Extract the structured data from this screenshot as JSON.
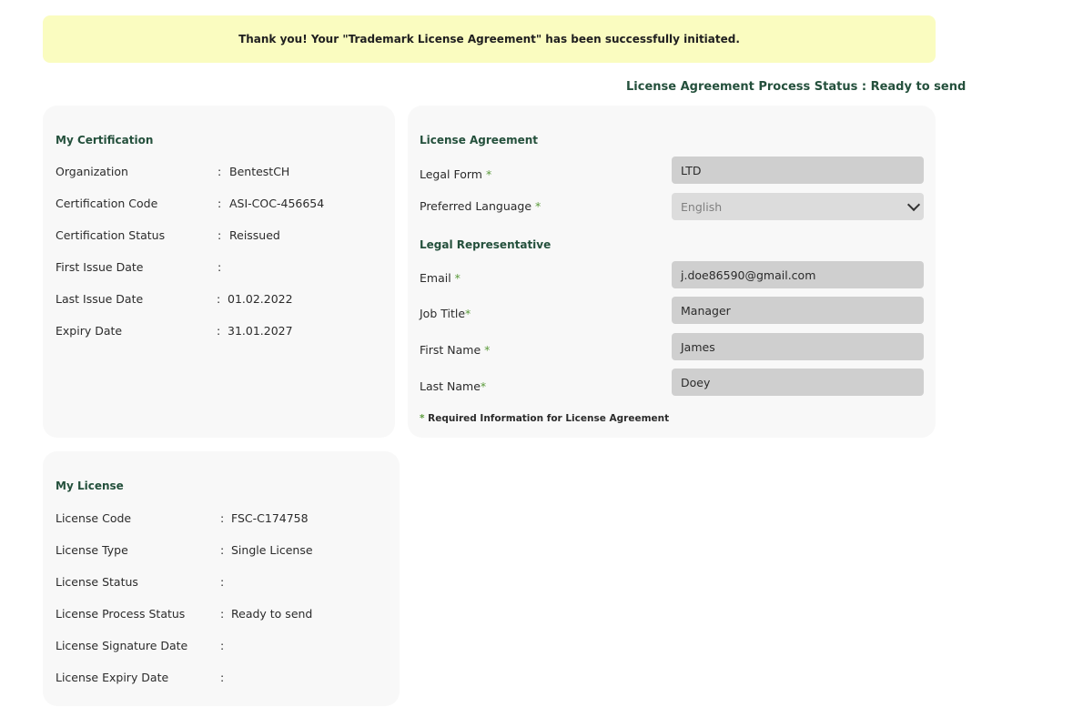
{
  "banner": {
    "message": "Thank you! Your \"Trademark License Agreement\" has been successfully initiated."
  },
  "process_status": "License Agreement Process Status : Ready to send",
  "certification": {
    "title": "My Certification",
    "rows": [
      {
        "label": "Organization",
        "value": "BentestCH"
      },
      {
        "label": "Certification Code",
        "value": "ASI-COC-456654"
      },
      {
        "label": "Certification Status",
        "value": "Reissued"
      },
      {
        "label": "First Issue Date",
        "value": ""
      },
      {
        "label": "Last Issue Date",
        "value": "01.02.2022"
      },
      {
        "label": "Expiry Date",
        "value": "31.01.2027"
      }
    ]
  },
  "license_agreement": {
    "title": "License Agreement",
    "legal_form_label": "Legal Form",
    "legal_form_value": "LTD",
    "language_label": "Preferred Language",
    "language_value": "English",
    "rep_title": "Legal Representative",
    "email_label": "Email",
    "email_value": "j.doe86590@gmail.com",
    "job_label": "Job Title",
    "job_value": "Manager",
    "first_label": "First Name",
    "first_value": "James",
    "last_label": "Last Name",
    "last_value": "Doey",
    "required_mark": "*",
    "note": "Required Information for License Agreement"
  },
  "license": {
    "title": "My License",
    "rows": [
      {
        "label": "License Code",
        "value": "FSC-C174758"
      },
      {
        "label": "License Type",
        "value": "Single License"
      },
      {
        "label": "License Status",
        "value": ""
      },
      {
        "label": "License Process Status",
        "value": "Ready to send"
      },
      {
        "label": "License Signature Date",
        "value": ""
      },
      {
        "label": "License Expiry Date",
        "value": ""
      }
    ]
  },
  "colon": ":"
}
